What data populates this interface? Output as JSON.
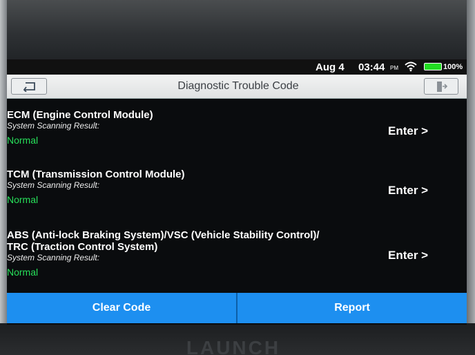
{
  "status_bar": {
    "date": "Aug 4",
    "time": "03:44",
    "ampm": "PM",
    "battery": "100%",
    "battery_level": 1.0,
    "wifi_icon": "wifi-icon"
  },
  "header": {
    "title": "Diagnostic Trouble Code",
    "back_icon": "back-arrow-icon",
    "exit_icon": "exit-icon"
  },
  "modules": [
    {
      "name_lines": [
        "ECM (Engine Control Module)"
      ],
      "scan_label": "System Scanning Result:",
      "result": "Normal",
      "action": "Enter >"
    },
    {
      "name_lines": [
        "TCM (Transmission Control Module)"
      ],
      "scan_label": "System Scanning Result:",
      "result": "Normal",
      "action": "Enter >"
    },
    {
      "name_lines": [
        "ABS (Anti-lock Braking System)/VSC (Vehicle Stability Control)/",
        "TRC (Traction Control System)"
      ],
      "scan_label": "System Scanning Result:",
      "result": "Normal",
      "action": "Enter >"
    }
  ],
  "footer": {
    "clear_code": "Clear Code",
    "report": "Report"
  },
  "device_brand": "LAUNCH",
  "colors": {
    "accent": "#1d8ff0",
    "status_normal": "#27e05a",
    "battery": "#22dd22"
  }
}
